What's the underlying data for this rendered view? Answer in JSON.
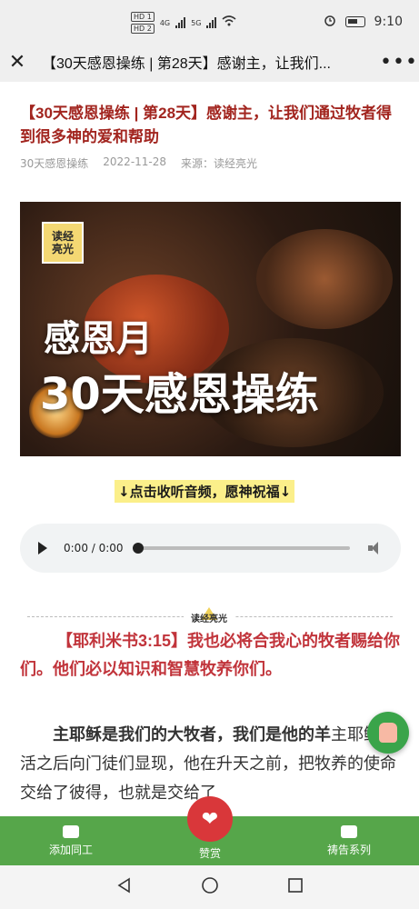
{
  "status_bar": {
    "time": "9:10",
    "network1": "4G",
    "network2": "5G",
    "hd1": "HD 1",
    "hd2": "HD 2"
  },
  "nav": {
    "title": "【30天感恩操练 | 第28天】感谢主，让我们..."
  },
  "article": {
    "title": "【30天感恩操练 | 第28天】感谢主，让我们通过牧者得到很多神的爱和帮助",
    "author": "30天感恩操练",
    "date": "2022-11-28",
    "source": "来源：读经亮光"
  },
  "cover": {
    "logo_line1": "读经",
    "logo_line2": "亮光",
    "heading1": "感恩月",
    "heading2": "30天感恩操练"
  },
  "audio": {
    "hint": "↓点击收听音频，愿神祝福↓",
    "time": "0:00 / 0:00",
    "progress": 0
  },
  "divider": {
    "label": "读经亮光"
  },
  "verse": {
    "text": "【耶利米书3:15】我也必将合我心的牧者赐给你们。他们必以知识和智慧牧养你们。"
  },
  "body": {
    "bold": "主耶稣是我们的大牧者，我们是他的羊",
    "text": "主耶稣复活之后向门徒们显现，他在升天之前，把牧养的使命交给了彼得，也就是交给了"
  },
  "bottom_bar": {
    "left": "添加同工",
    "center": "赞赏",
    "right": "祷告系列"
  },
  "colors": {
    "title_red": "#a2251f",
    "verse_red": "#c1343b",
    "bar_green": "#56a64a",
    "like_red": "#d9373a"
  }
}
